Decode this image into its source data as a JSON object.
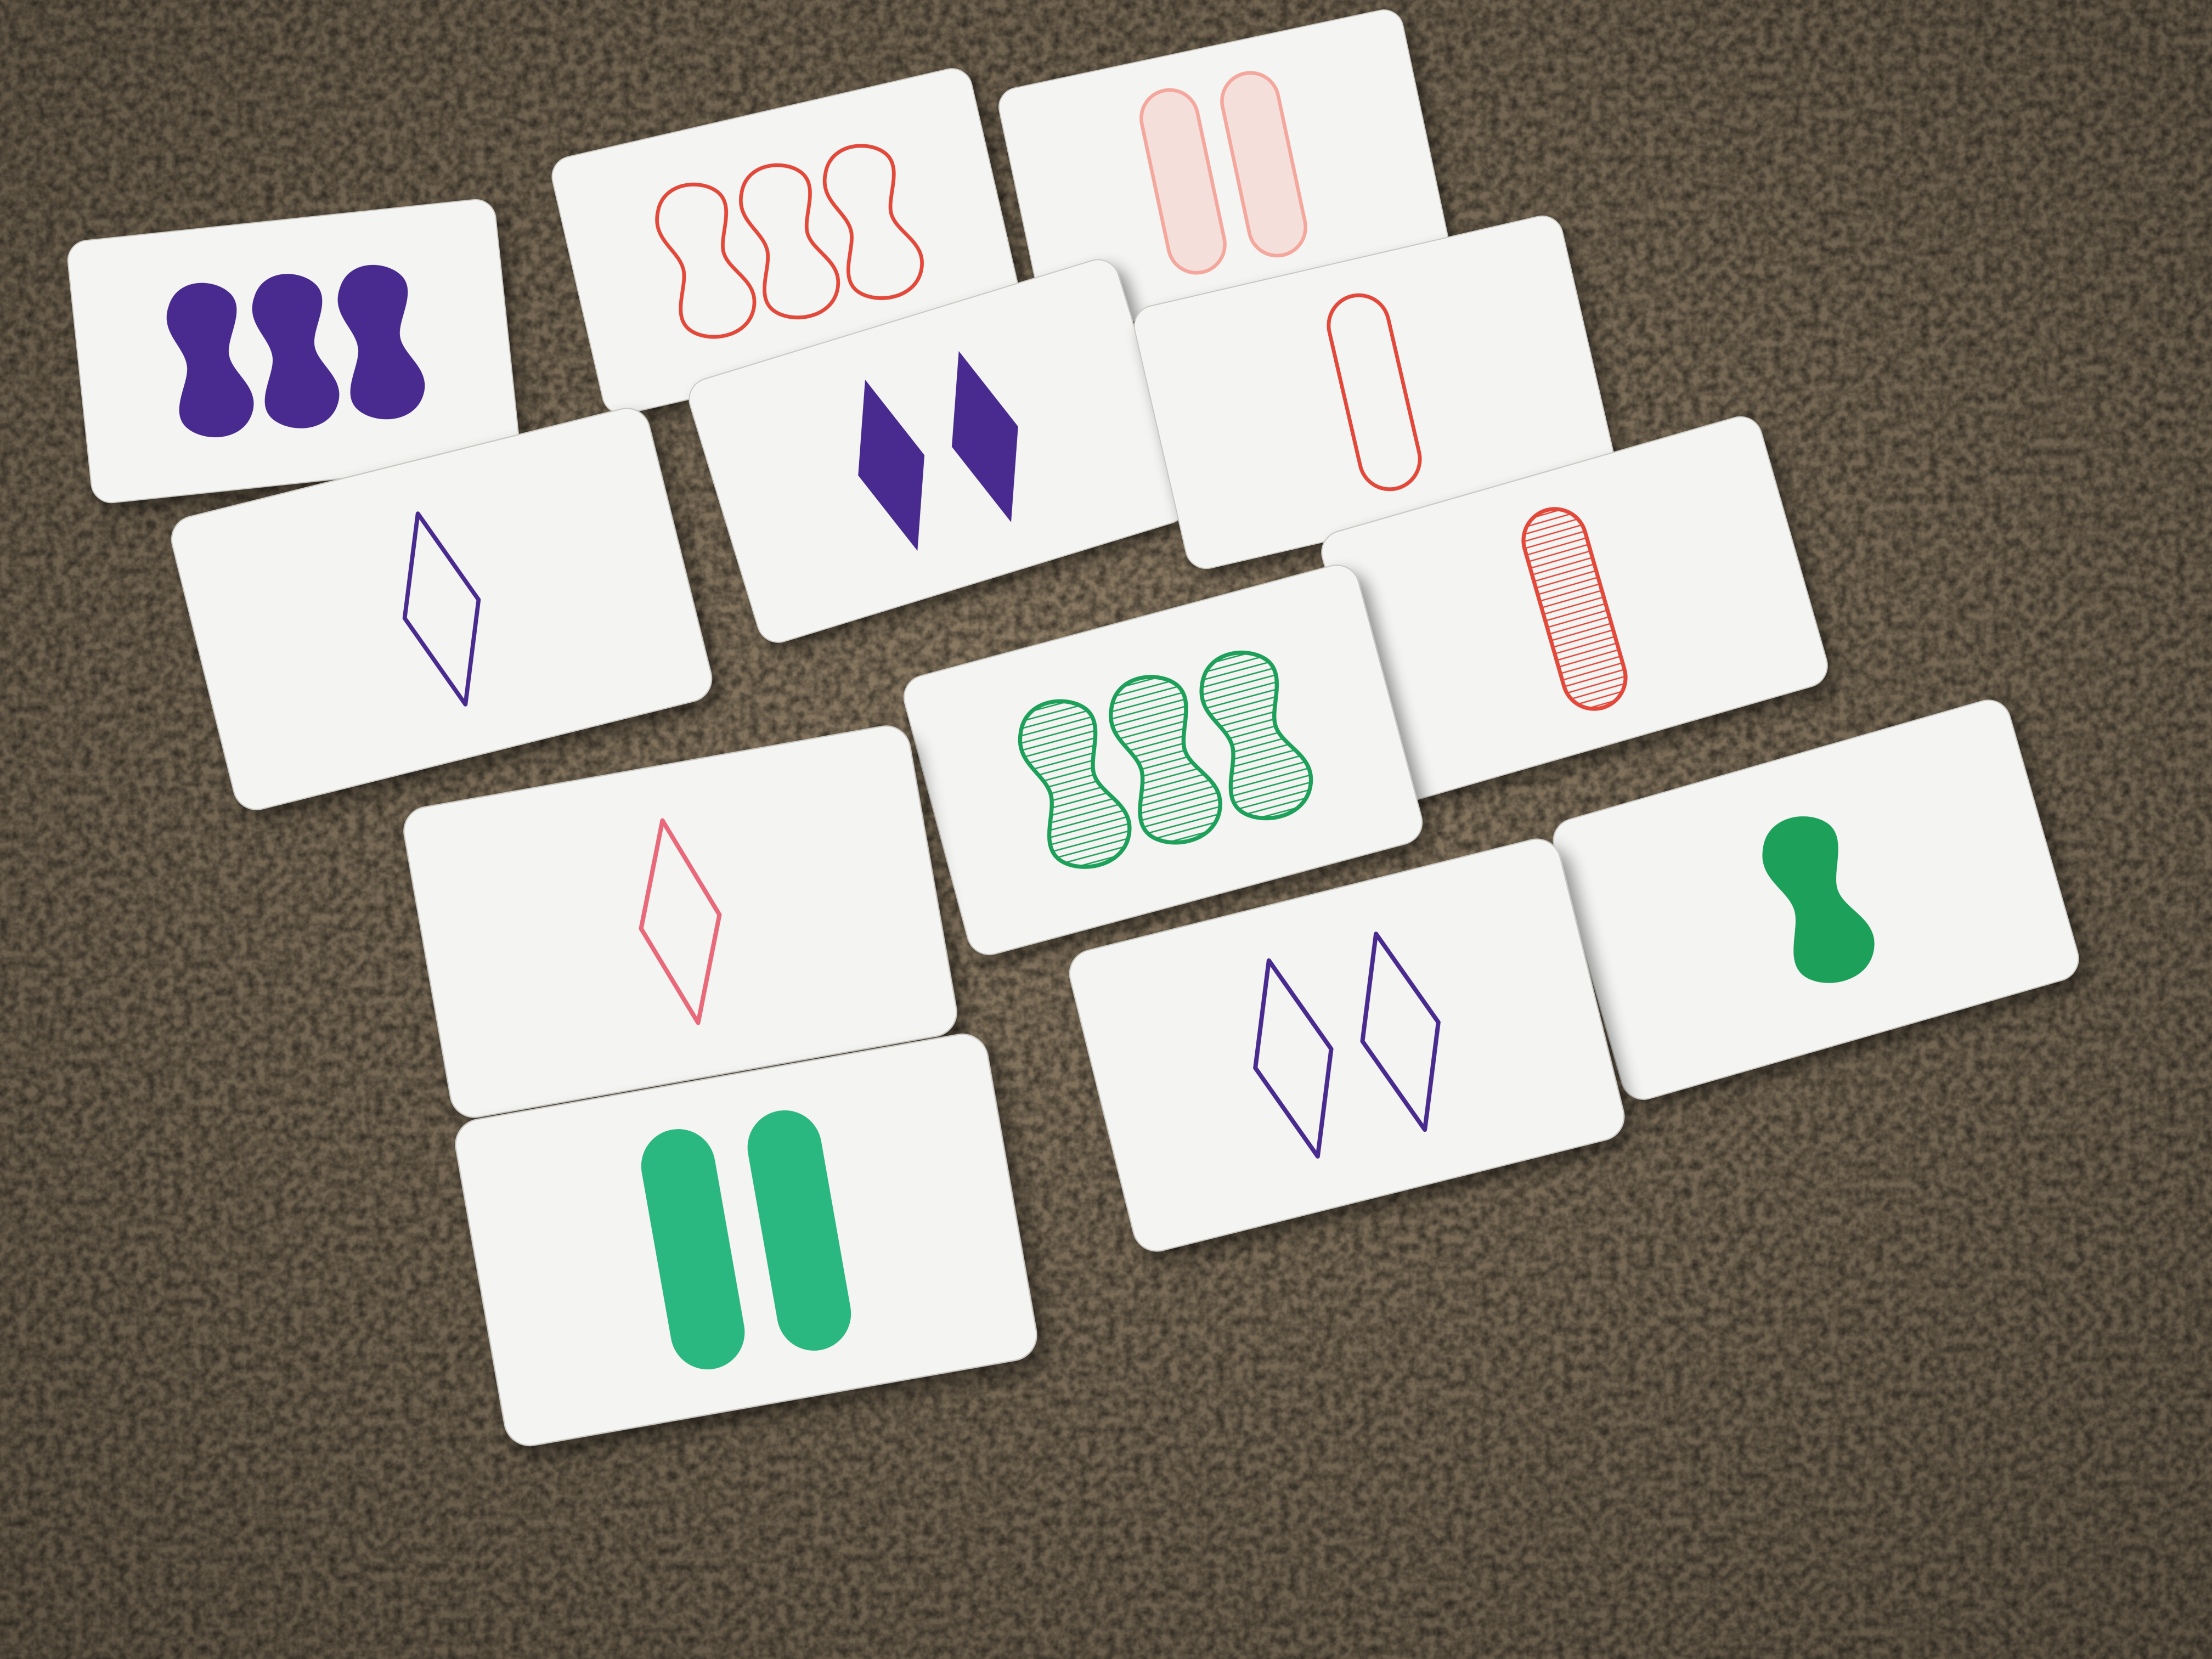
{
  "scene": {
    "surface": "carpet",
    "colors": {
      "carpet": "#8f7e66",
      "card": "#f4f4f2",
      "card_edge": "#c9c7c2",
      "purple": "#4a2a8f",
      "red": "#e24a3a",
      "red_light": "#f4a79d",
      "pink": "#e86a7a",
      "green": "#1ea05a",
      "teal": "#2bb880"
    }
  },
  "cards": [
    {
      "id": "card-1",
      "count": 3,
      "shape": "squiggle",
      "color": "purple",
      "fill": "solid"
    },
    {
      "id": "card-2",
      "count": 3,
      "shape": "squiggle",
      "color": "red",
      "fill": "outline"
    },
    {
      "id": "card-3",
      "count": 2,
      "shape": "oval",
      "color": "red_light",
      "fill": "shaded"
    },
    {
      "id": "card-4",
      "count": 2,
      "shape": "diamond",
      "color": "purple",
      "fill": "solid"
    },
    {
      "id": "card-5",
      "count": 1,
      "shape": "oval",
      "color": "red",
      "fill": "outline"
    },
    {
      "id": "card-6",
      "count": 1,
      "shape": "diamond",
      "color": "purple",
      "fill": "outline"
    },
    {
      "id": "card-7",
      "count": 1,
      "shape": "oval",
      "color": "red",
      "fill": "striped"
    },
    {
      "id": "card-8",
      "count": 3,
      "shape": "squiggle",
      "color": "green",
      "fill": "striped"
    },
    {
      "id": "card-9",
      "count": 1,
      "shape": "diamond",
      "color": "pink",
      "fill": "outline"
    },
    {
      "id": "card-10",
      "count": 1,
      "shape": "squiggle",
      "color": "green",
      "fill": "solid"
    },
    {
      "id": "card-11",
      "count": 2,
      "shape": "diamond",
      "color": "purple",
      "fill": "outline"
    },
    {
      "id": "card-12",
      "count": 2,
      "shape": "oval",
      "color": "teal",
      "fill": "solid"
    }
  ]
}
